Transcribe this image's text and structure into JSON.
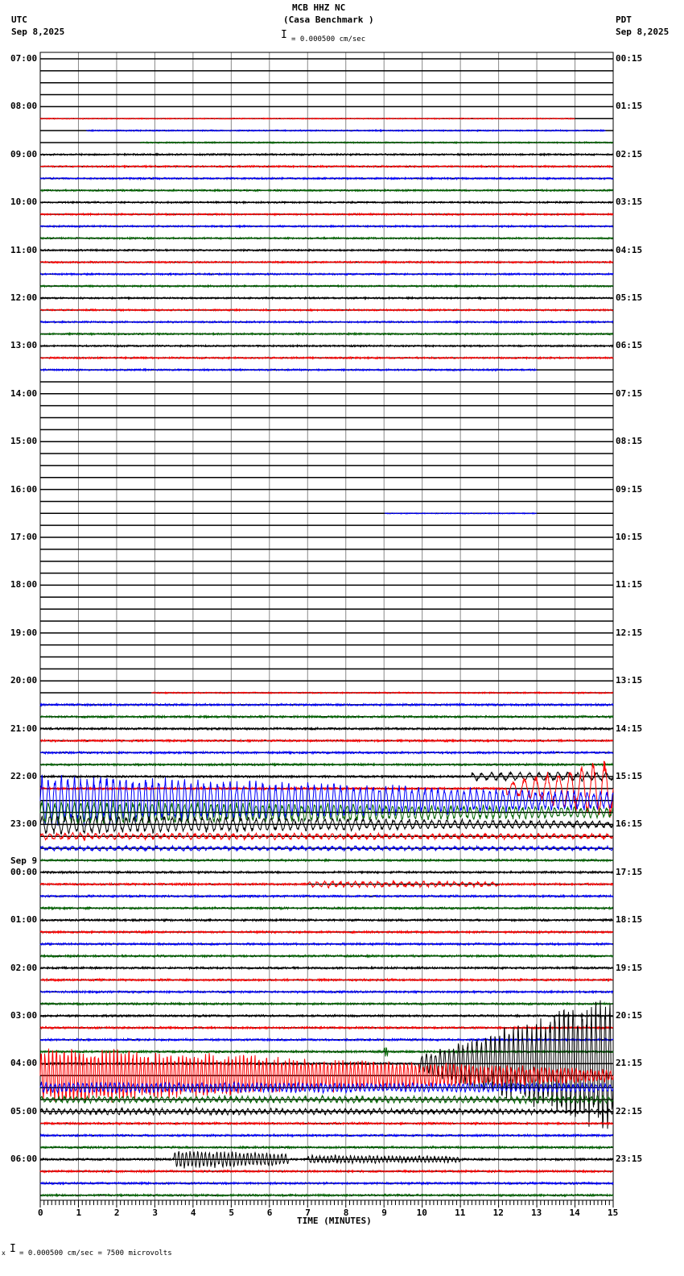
{
  "header": {
    "station": "MCB HHZ NC",
    "site": "(Casa Benchmark )",
    "left_tz": "UTC",
    "left_date": "Sep 8,2025",
    "right_tz": "PDT",
    "right_date": "Sep 8,2025",
    "scale_text": "= 0.000500 cm/sec"
  },
  "footer": {
    "prefix": "x",
    "scale_text": "= 0.000500 cm/sec =    7500 microvolts"
  },
  "chart_data": {
    "type": "line",
    "title": "MCB HHZ NC (Casa Benchmark )",
    "xlabel": "TIME (MINUTES)",
    "xlim": [
      0,
      15
    ],
    "xticks": [
      "0",
      "1",
      "2",
      "3",
      "4",
      "5",
      "6",
      "7",
      "8",
      "9",
      "10",
      "11",
      "12",
      "13",
      "14",
      "15"
    ],
    "colors": [
      "#000000",
      "#ff0000",
      "#0000ff",
      "#006400"
    ],
    "left_labels": [
      "07:00",
      "08:00",
      "09:00",
      "10:00",
      "11:00",
      "12:00",
      "13:00",
      "14:00",
      "15:00",
      "16:00",
      "17:00",
      "18:00",
      "19:00",
      "20:00",
      "21:00",
      "22:00",
      "23:00",
      "00:00",
      "01:00",
      "02:00",
      "03:00",
      "04:00",
      "05:00",
      "06:00"
    ],
    "day_change_label": "Sep 9",
    "right_labels": [
      "00:15",
      "01:15",
      "02:15",
      "03:15",
      "04:15",
      "05:15",
      "06:15",
      "07:15",
      "08:15",
      "09:15",
      "10:15",
      "11:15",
      "12:15",
      "13:15",
      "14:15",
      "15:15",
      "16:15",
      "17:15",
      "18:15",
      "19:15",
      "20:15",
      "21:15",
      "22:15",
      "23:15"
    ],
    "trace_noise": [
      0,
      0,
      0,
      0,
      0,
      0.6,
      0.8,
      0.8,
      1,
      1,
      1,
      1,
      1,
      1,
      1,
      1,
      1,
      1,
      1,
      1,
      1,
      1,
      1,
      1,
      1,
      1,
      1,
      0,
      0,
      0,
      0,
      0,
      0,
      0,
      0,
      0,
      0,
      0,
      0.6,
      0,
      0,
      0,
      0,
      0,
      0,
      0,
      0,
      0,
      0,
      0,
      0,
      0,
      0,
      0.8,
      1.2,
      1.2,
      1.2,
      1.2,
      1.2,
      1.2,
      1.2,
      1.2,
      1.2,
      1.2,
      1.2,
      1.2,
      1.2,
      1.2,
      1.2,
      1.2,
      1.2,
      1.2,
      1.2,
      1.2,
      1.2,
      1.2,
      1.2,
      1.2,
      1.2,
      1.2,
      1.2,
      1.2,
      1.2,
      1.2,
      1.2,
      1.2,
      1.2,
      1.2,
      1.2,
      1.2,
      1.2,
      1.2,
      1.2,
      1.2,
      1.2,
      1.2
    ],
    "trace_segments": {
      "5": [
        0,
        14
      ],
      "6": [
        1.2,
        14.8
      ],
      "7": [
        2.6,
        15
      ],
      "26": [
        0,
        13
      ],
      "38": [
        9,
        13
      ],
      "53": [
        2.9,
        15
      ]
    },
    "events": [
      {
        "trace": 60,
        "t0": 11.3,
        "t1": 15,
        "amp": 4,
        "amp_end": 4,
        "period": 0.25
      },
      {
        "trace": 61,
        "t0": 12.2,
        "t1": 15,
        "amp": 6,
        "amp_end": 30,
        "period": 0.3
      },
      {
        "trace": 62,
        "t0": 0,
        "t1": 15,
        "amp": 26,
        "amp_end": 8,
        "period": 0.17
      },
      {
        "trace": 63,
        "t0": 0,
        "t1": 15,
        "amp": 12,
        "amp_end": 5,
        "period": 0.17
      },
      {
        "trace": 64,
        "t0": 0,
        "t1": 15,
        "amp": 9,
        "amp_end": 3,
        "period": 0.2
      },
      {
        "trace": 65,
        "t0": 0,
        "t1": 15,
        "amp": 3,
        "amp_end": 2,
        "period": 0.2
      },
      {
        "trace": 66,
        "t0": 0,
        "t1": 15,
        "amp": 2,
        "amp_end": 1.5,
        "period": 0.2
      },
      {
        "trace": 69,
        "t0": 7,
        "t1": 12,
        "amp": 3,
        "amp_end": 2,
        "period": 0.2
      },
      {
        "trace": 83,
        "t0": 9,
        "t1": 9.1,
        "amp": 5,
        "amp_end": 5,
        "period": 0.05
      },
      {
        "trace": 84,
        "t0": 9.9,
        "t1": 15,
        "amp": 8,
        "amp_end": 70,
        "period": 0.12
      },
      {
        "trace": 85,
        "t0": 0,
        "t1": 15,
        "amp": 28,
        "amp_end": 6,
        "period": 0.1
      },
      {
        "trace": 86,
        "t0": 0,
        "t1": 15,
        "amp": 5,
        "amp_end": 4,
        "period": 0.12
      },
      {
        "trace": 87,
        "t0": 0,
        "t1": 15,
        "amp": 3,
        "amp_end": 3,
        "period": 0.15
      },
      {
        "trace": 88,
        "t0": 0,
        "t1": 15,
        "amp": 3,
        "amp_end": 2,
        "period": 0.15
      },
      {
        "trace": 92,
        "t0": 3.5,
        "t1": 6.5,
        "amp": 9,
        "amp_end": 6,
        "period": 0.1
      },
      {
        "trace": 92,
        "t0": 7,
        "t1": 11,
        "amp": 4,
        "amp_end": 3,
        "period": 0.1
      }
    ]
  }
}
